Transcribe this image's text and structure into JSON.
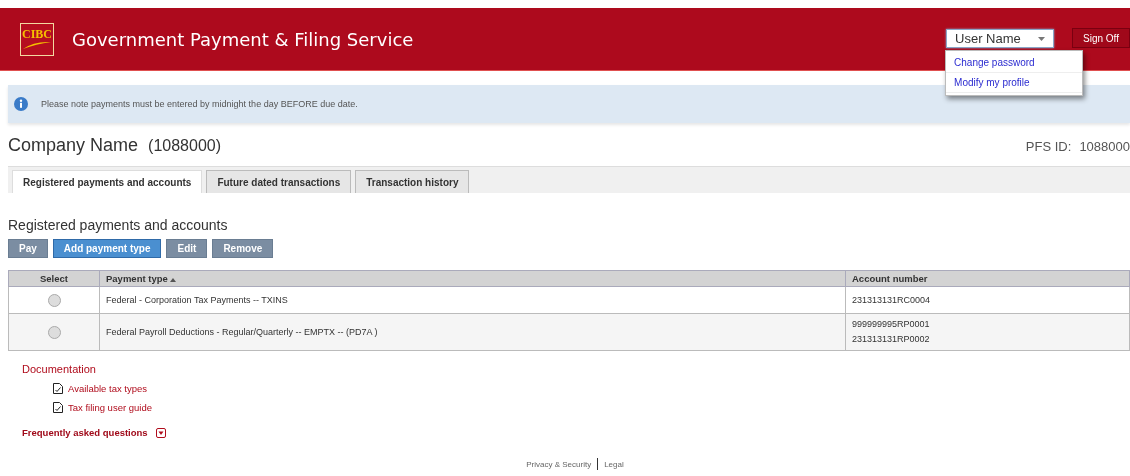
{
  "header": {
    "logo": "CIBC",
    "title": "Government Payment & Filing Service",
    "user_menu": {
      "label": "User Name",
      "expanded": true,
      "items": [
        "Change password",
        "Modify my profile"
      ]
    },
    "sign_off": "Sign Off"
  },
  "notice": "Please note payments must be entered by midnight the day BEFORE due date.",
  "company": {
    "name": "Company Name",
    "number": "(1088000)",
    "pfs_label": "PFS ID:",
    "pfs_id": "1088000"
  },
  "tabs": [
    {
      "label": "Registered payments and accounts",
      "selected": true
    },
    {
      "label": "Future dated transactions",
      "selected": false
    },
    {
      "label": "Transaction history",
      "selected": false
    }
  ],
  "section_title": "Registered payments and accounts",
  "buttons": [
    {
      "label": "Pay",
      "kind": "plain"
    },
    {
      "label": "Add payment type",
      "kind": "primary"
    },
    {
      "label": "Edit",
      "kind": "plain"
    },
    {
      "label": "Remove",
      "kind": "plain"
    }
  ],
  "table": {
    "columns": [
      "Select",
      "Payment type",
      "Account number"
    ],
    "rows": [
      {
        "selected": false,
        "payment_type": "Federal - Corporation Tax Payments -- TXINS",
        "accounts": [
          "231313131RC0004"
        ]
      },
      {
        "selected": false,
        "payment_type": "Federal Payroll Deductions - Regular/Quarterly -- EMPTX -- (PD7A )",
        "accounts": [
          "999999995RP0001",
          "231313131RP0002"
        ]
      }
    ]
  },
  "documentation": {
    "title": "Documentation",
    "links": [
      "Available tax types",
      "Tax filing user guide"
    ]
  },
  "faq": {
    "label": "Frequently asked questions",
    "expanded": false
  },
  "footer": [
    "Privacy & Security",
    "Legal"
  ]
}
